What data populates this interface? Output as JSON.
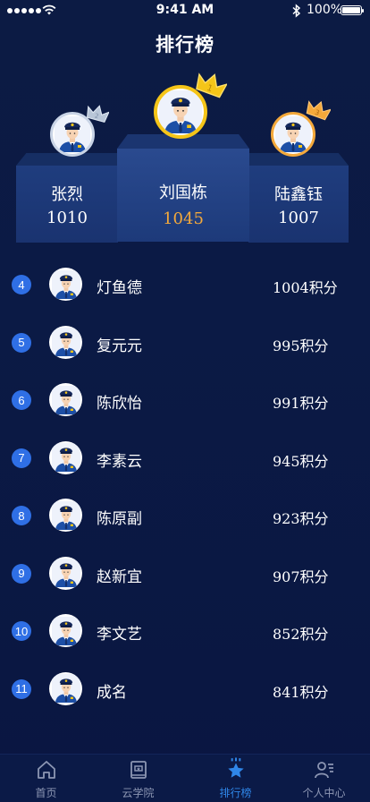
{
  "status_bar": {
    "time": "9:41 AM",
    "battery_percent": "100%",
    "battery_level": 1.0,
    "signal_bars": 5
  },
  "page": {
    "title": "排行榜"
  },
  "podium": {
    "first": {
      "rank": 1,
      "name": "刘国栋",
      "score": "1045"
    },
    "second": {
      "rank": 2,
      "name": "张烈",
      "score": "1010"
    },
    "third": {
      "rank": 3,
      "name": "陆鑫钰",
      "score": "1007"
    }
  },
  "ranking": [
    {
      "rank": "4",
      "name": "灯鱼德",
      "points": "1004积分"
    },
    {
      "rank": "5",
      "name": "复元元",
      "points": "995积分"
    },
    {
      "rank": "6",
      "name": "陈欣怡",
      "points": "991积分"
    },
    {
      "rank": "7",
      "name": "李素云",
      "points": "945积分"
    },
    {
      "rank": "8",
      "name": "陈原副",
      "points": "923积分"
    },
    {
      "rank": "9",
      "name": "赵新宜",
      "points": "907积分"
    },
    {
      "rank": "10",
      "name": "李文艺",
      "points": "852积分"
    },
    {
      "rank": "11",
      "name": "成名",
      "points": "841积分"
    }
  ],
  "tab_bar": {
    "items": [
      {
        "label": "首页",
        "icon": "home-icon"
      },
      {
        "label": "云学院",
        "icon": "book-icon"
      },
      {
        "label": "排行榜",
        "icon": "star-icon",
        "active": true
      },
      {
        "label": "个人中心",
        "icon": "profile-icon"
      }
    ]
  },
  "colors": {
    "background": "#0c1b44",
    "accent_blue": "#2f86e8",
    "gold": "#f4a93b",
    "rank_badge": "#2f6fe5",
    "tab_inactive": "#8c96b3"
  }
}
